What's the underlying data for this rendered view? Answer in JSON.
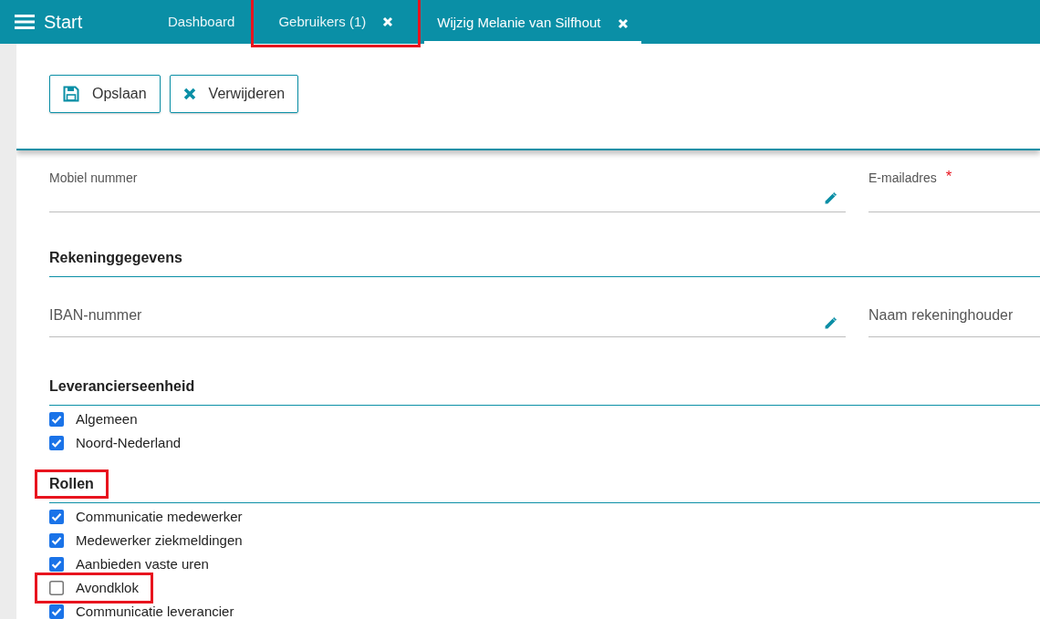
{
  "header": {
    "title": "Start",
    "tabs": [
      {
        "label": "Dashboard",
        "selected": false,
        "closable": false,
        "highlighted": false
      },
      {
        "label": "Gebruikers (1)",
        "selected": false,
        "closable": true,
        "highlighted": true
      },
      {
        "label": "Wijzig Melanie van Silfhout",
        "selected": true,
        "closable": true,
        "highlighted": false
      }
    ]
  },
  "toolbar": [
    {
      "kind": "save",
      "label": "Opslaan"
    },
    {
      "kind": "delete",
      "label": "Verwijderen"
    }
  ],
  "field_rows": [
    {
      "fields": [
        {
          "label": "Mobiel nummer",
          "editable": true
        },
        {
          "label": "E-mailadres",
          "required_mark": "*",
          "editable": false
        }
      ]
    }
  ],
  "sections": [
    {
      "title": "Rekeninggegevens",
      "highlighted": false,
      "fields": [
        {
          "placeholder": "IBAN-nummer",
          "editable": true
        },
        {
          "placeholder": "Naam rekeninghouder",
          "editable": false
        }
      ]
    },
    {
      "title": "Leverancierseenheid",
      "highlighted": false,
      "options": [
        {
          "label": "Algemeen",
          "checked": true,
          "highlighted": false
        },
        {
          "label": "Noord-Nederland",
          "checked": true,
          "highlighted": false
        }
      ]
    },
    {
      "title": "Rollen",
      "highlighted": true,
      "options": [
        {
          "label": "Communicatie medewerker",
          "checked": true,
          "highlighted": false
        },
        {
          "label": "Medewerker ziekmeldingen",
          "checked": true,
          "highlighted": false
        },
        {
          "label": "Aanbieden vaste uren",
          "checked": true,
          "highlighted": false
        },
        {
          "label": "Avondklok",
          "checked": false,
          "highlighted": true
        },
        {
          "label": "Communicatie leverancier",
          "checked": true,
          "highlighted": false
        }
      ]
    }
  ]
}
